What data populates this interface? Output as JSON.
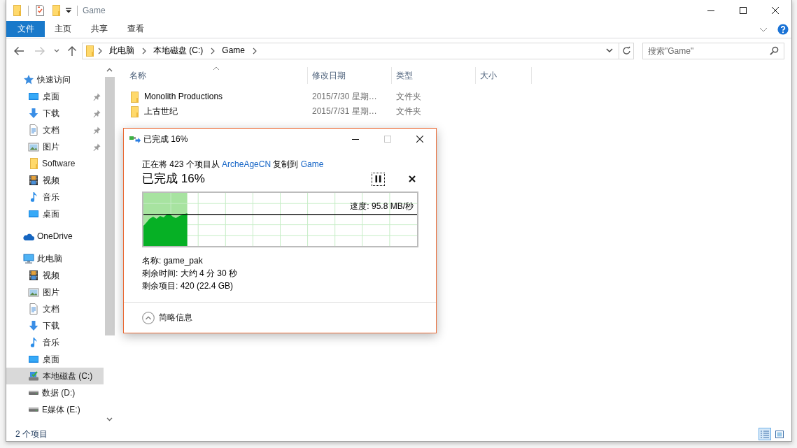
{
  "window": {
    "title": "Game"
  },
  "ribbon": {
    "tabs": [
      {
        "label": "文件",
        "kind": "file-menu",
        "selected": false
      },
      {
        "label": "主页",
        "kind": "tab",
        "selected": false
      },
      {
        "label": "共享",
        "kind": "tab",
        "selected": false
      },
      {
        "label": "查看",
        "kind": "tab",
        "selected": false
      }
    ]
  },
  "address_bar": {
    "path": [
      "此电脑",
      "本地磁盘 (C:)",
      "Game"
    ]
  },
  "search": {
    "placeholder": "搜索\"Game\""
  },
  "sidebar": {
    "items": [
      {
        "label": "快速访问",
        "kind": "quick-access",
        "selected": false,
        "children": [
          {
            "label": "桌面",
            "kind": "desktop",
            "selected": false,
            "pinned": true
          },
          {
            "label": "下载",
            "kind": "download",
            "selected": false,
            "pinned": true
          },
          {
            "label": "文档",
            "kind": "document",
            "selected": false,
            "pinned": true
          },
          {
            "label": "图片",
            "kind": "picture",
            "selected": false,
            "pinned": true
          },
          {
            "label": "Software",
            "kind": "folder",
            "selected": false,
            "pinned": false
          },
          {
            "label": "视频",
            "kind": "video",
            "selected": false,
            "pinned": false
          },
          {
            "label": "音乐",
            "kind": "music",
            "selected": false,
            "pinned": false
          },
          {
            "label": "桌面",
            "kind": "desktop",
            "selected": false,
            "pinned": false
          }
        ]
      },
      {
        "label": "OneDrive",
        "kind": "onedrive",
        "selected": false
      },
      {
        "label": "此电脑",
        "kind": "pc",
        "selected": false,
        "children": [
          {
            "label": "视频",
            "kind": "video",
            "selected": false
          },
          {
            "label": "图片",
            "kind": "picture",
            "selected": false
          },
          {
            "label": "文档",
            "kind": "document",
            "selected": false
          },
          {
            "label": "下载",
            "kind": "download",
            "selected": false
          },
          {
            "label": "音乐",
            "kind": "music",
            "selected": false
          },
          {
            "label": "桌面",
            "kind": "desktop",
            "selected": false
          },
          {
            "label": "本地磁盘 (C:)",
            "kind": "system-drive",
            "selected": true
          },
          {
            "label": "数据 (D:)",
            "kind": "drive",
            "selected": false
          },
          {
            "label": "E媒体 (E:)",
            "kind": "drive",
            "selected": false
          }
        ]
      }
    ]
  },
  "file_list": {
    "columns": [
      {
        "label": "名称",
        "sorted": true
      },
      {
        "label": "修改日期",
        "sorted": false
      },
      {
        "label": "类型",
        "sorted": false
      },
      {
        "label": "大小",
        "sorted": false
      }
    ],
    "rows": [
      {
        "name": "Monolith Productions",
        "modified": "2015/7/30 星期…",
        "type": "文件夹",
        "selected": false
      },
      {
        "name": "上古世纪",
        "modified": "2015/7/31 星期…",
        "type": "文件夹",
        "selected": false
      }
    ]
  },
  "status_bar": {
    "text": "2 个项目",
    "views": [
      {
        "kind": "details",
        "selected": true
      },
      {
        "kind": "large-icons",
        "selected": false
      }
    ]
  },
  "copy_dialog": {
    "title": "已完成 16%",
    "description": [
      {
        "kind": "text",
        "text": "正在将 423 个项目从 "
      },
      {
        "kind": "link",
        "text": "ArcheAgeCN"
      },
      {
        "kind": "text",
        "text": " 复制到 "
      },
      {
        "kind": "link",
        "text": "Game"
      }
    ],
    "status": "已完成 16%",
    "progress": {
      "level": 0.16
    },
    "speed": "速度: 95.8 MB/秒",
    "details": [
      "名称: game_pak",
      "剩余时间: 大约 4 分 30 秒",
      "剩余项目: 420 (22.4 GB)"
    ],
    "details_expanded": true,
    "toggle": "简略信息"
  }
}
